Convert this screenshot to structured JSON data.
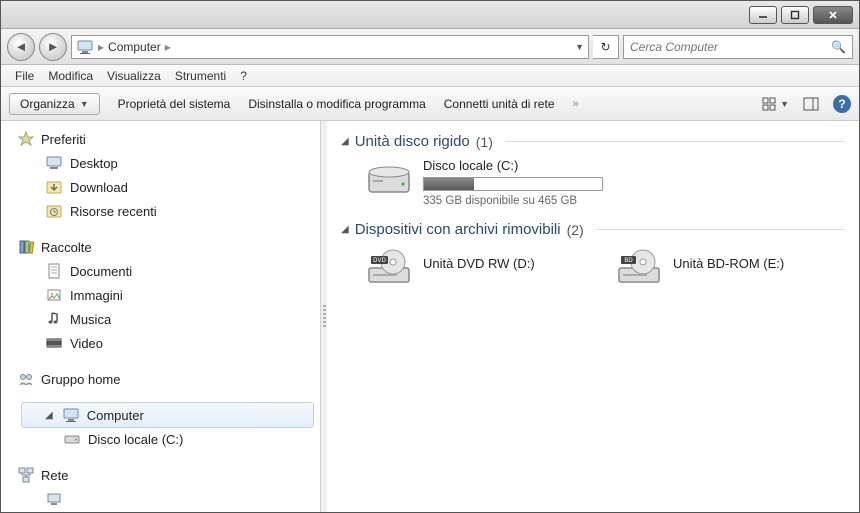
{
  "titlebar": {},
  "nav": {
    "breadcrumb_root_icon": "computer-icon",
    "breadcrumb_label": "Computer"
  },
  "search": {
    "placeholder": "Cerca Computer"
  },
  "menu": {
    "file": "File",
    "modify": "Modifica",
    "view": "Visualizza",
    "tools": "Strumenti",
    "help": "?"
  },
  "toolbar": {
    "organize": "Organizza",
    "system_props": "Proprietà del sistema",
    "uninstall": "Disinstalla o modifica programma",
    "map_drive": "Connetti unità di rete",
    "overflow": "»"
  },
  "sidebar": {
    "favorites": {
      "label": "Preferiti",
      "items": [
        {
          "label": "Desktop",
          "icon": "desktop-icon"
        },
        {
          "label": "Download",
          "icon": "download-icon"
        },
        {
          "label": "Risorse recenti",
          "icon": "recent-icon"
        }
      ]
    },
    "libraries": {
      "label": "Raccolte",
      "items": [
        {
          "label": "Documenti",
          "icon": "documents-icon"
        },
        {
          "label": "Immagini",
          "icon": "images-icon"
        },
        {
          "label": "Musica",
          "icon": "music-icon"
        },
        {
          "label": "Video",
          "icon": "video-icon"
        }
      ]
    },
    "homegroup": {
      "label": "Gruppo home"
    },
    "computer": {
      "label": "Computer",
      "items": [
        {
          "label": "Disco locale (C:)",
          "icon": "hdd-icon"
        }
      ]
    },
    "network": {
      "label": "Rete"
    }
  },
  "content": {
    "sections": [
      {
        "title": "Unità disco rigido",
        "count": "(1)",
        "kind": "hdd",
        "items": [
          {
            "name": "Disco locale (C:)",
            "free_text": "335 GB disponibile su 465 GB",
            "used_fraction": 0.28
          }
        ]
      },
      {
        "title": "Dispositivi con archivi rimovibili",
        "count": "(2)",
        "kind": "removable",
        "items": [
          {
            "name": "Unità DVD RW (D:)",
            "badge": "DVD"
          },
          {
            "name": "Unità BD-ROM (E:)",
            "badge": "BD"
          }
        ]
      }
    ]
  }
}
